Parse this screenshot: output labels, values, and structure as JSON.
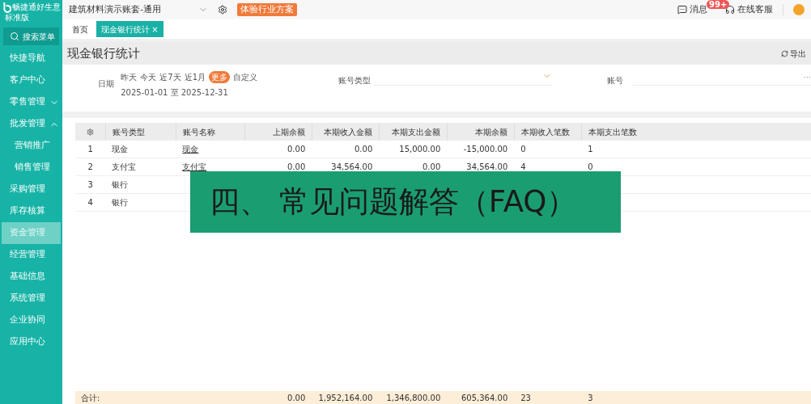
{
  "brand": {
    "name": "畅捷通好生意",
    "edition": "标准版"
  },
  "sidebar": {
    "search": "搜索菜单",
    "items": [
      {
        "label": "快捷导航",
        "selected": false
      },
      {
        "label": "客户中心",
        "selected": false
      },
      {
        "label": "零售管理",
        "selected": false,
        "expanded": false
      },
      {
        "label": "批发管理",
        "selected": false,
        "expanded": true,
        "children": [
          {
            "label": "营销推广",
            "selected": false
          },
          {
            "label": "销售管理",
            "selected": false
          }
        ]
      },
      {
        "label": "采购管理",
        "selected": false
      },
      {
        "label": "库存核算",
        "selected": false
      },
      {
        "label": "资金管理",
        "selected": true
      },
      {
        "label": "经营管理",
        "selected": false
      },
      {
        "label": "基础信息",
        "selected": false
      },
      {
        "label": "系统管理",
        "selected": false
      },
      {
        "label": "企业协同",
        "selected": false
      },
      {
        "label": "应用中心",
        "selected": false
      }
    ]
  },
  "topbar": {
    "account_set": "建筑材料演示账套-通用",
    "promo": "体验行业方案",
    "messages": "消息",
    "badge": "99+",
    "support": "在线客服"
  },
  "tabs": [
    {
      "label": "首页",
      "selected": false,
      "closable": false
    },
    {
      "label": "现金银行统计",
      "selected": true,
      "closable": true
    }
  ],
  "close_glyph": "×",
  "page_title": "现金银行统计",
  "export": "导出",
  "filters": {
    "date_label": "日期",
    "quick": [
      {
        "label": "昨天",
        "selected": false
      },
      {
        "label": "今天",
        "selected": false
      },
      {
        "label": "近7天",
        "selected": false
      },
      {
        "label": "近1月",
        "selected": false
      },
      {
        "label": "更多",
        "selected": true
      },
      {
        "label": "自定义",
        "selected": false
      }
    ],
    "range": "2025-01-01 至 2025-12-31",
    "type_label": "账号类型",
    "account_label": "账号",
    "account_more": "···"
  },
  "table": {
    "columns": [
      "",
      "账号类型",
      "账号名称",
      "上期余额",
      "本期收入金额",
      "本期支出金额",
      "本期余额",
      "本期收入笔数",
      "本期支出笔数"
    ],
    "rows": [
      {
        "cells": [
          "1",
          "现金",
          "现金",
          "0.00",
          "0.00",
          "15,000.00",
          "-15,000.00",
          "0",
          "1"
        ]
      },
      {
        "cells": [
          "2",
          "支付宝",
          "支付宝",
          "0.00",
          "34,564.00",
          "0.00",
          "34,564.00",
          "4",
          "0"
        ]
      },
      {
        "cells": [
          "3",
          "银行"
        ]
      },
      {
        "cells": [
          "4",
          "银行"
        ]
      }
    ],
    "total": {
      "cells": [
        "合计:",
        "",
        "",
        "0.00",
        "1,952,164.00",
        "1,346,800.00",
        "605,364.00",
        "23",
        "3"
      ]
    }
  },
  "banner": "四、 常见问题解答（FAQ）"
}
